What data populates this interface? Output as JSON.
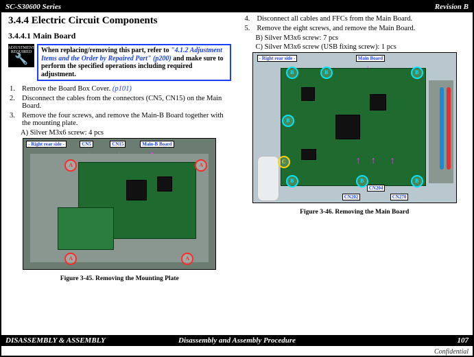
{
  "header": {
    "series": "SC-S30600 Series",
    "revision": "Revision B"
  },
  "section": {
    "num": "3.4.4",
    "title": "Electric Circuit Components",
    "subnum": "3.4.4.1",
    "subtitle": "Main Board"
  },
  "callout": {
    "iconTop": "ADJUSTMENT",
    "iconBot": "REQUIRED",
    "t1": "When replacing/removing this part, refer to ",
    "link": "\"4.1.2 Adjustment Items and the Order by Repaired Part\" (p200)",
    "t2": " and make sure to perform the specified operations including required adjustment."
  },
  "stepsL": [
    {
      "n": "1.",
      "t": "Remove the Board Box Cover. ",
      "pg": "(p101)"
    },
    {
      "n": "2.",
      "t": "Disconnect the cables from the connectors (CN5, CN15) on the Main Board."
    },
    {
      "n": "3.",
      "t": "Remove the four screws, and remove the Main-B Board together with the mounting plate."
    }
  ],
  "sub3": "A) Silver M3x6 screw: 4 pcs",
  "stepsR": [
    {
      "n": "4.",
      "t": "Disconnect all cables and FFCs from the Main Board."
    },
    {
      "n": "5.",
      "t": "Remove the eight screws, and remove the Main Board."
    }
  ],
  "sub5b": "B) Silver M3x6 screw: 7 pcs",
  "sub5c": "C) Silver M3x6 screw (USB fixing screw): 1 pcs",
  "fig45": {
    "side": "- Right rear side -",
    "cn5": "CN5",
    "cn15": "CN15",
    "mainb": "Main-B Board",
    "caption": "Figure 3-45.  Removing the Mounting Plate"
  },
  "fig46": {
    "side": "- Right rear side -",
    "main": "Main Board",
    "cn202": "CN202",
    "cn204": "CN204",
    "cn270": "CN270",
    "caption": "Figure 3-46.  Removing the Main Board"
  },
  "footer": {
    "L": "DISASSEMBLY & ASSEMBLY",
    "C": "Disassembly and Assembly Procedure",
    "R": "107",
    "conf": "Confidential"
  }
}
